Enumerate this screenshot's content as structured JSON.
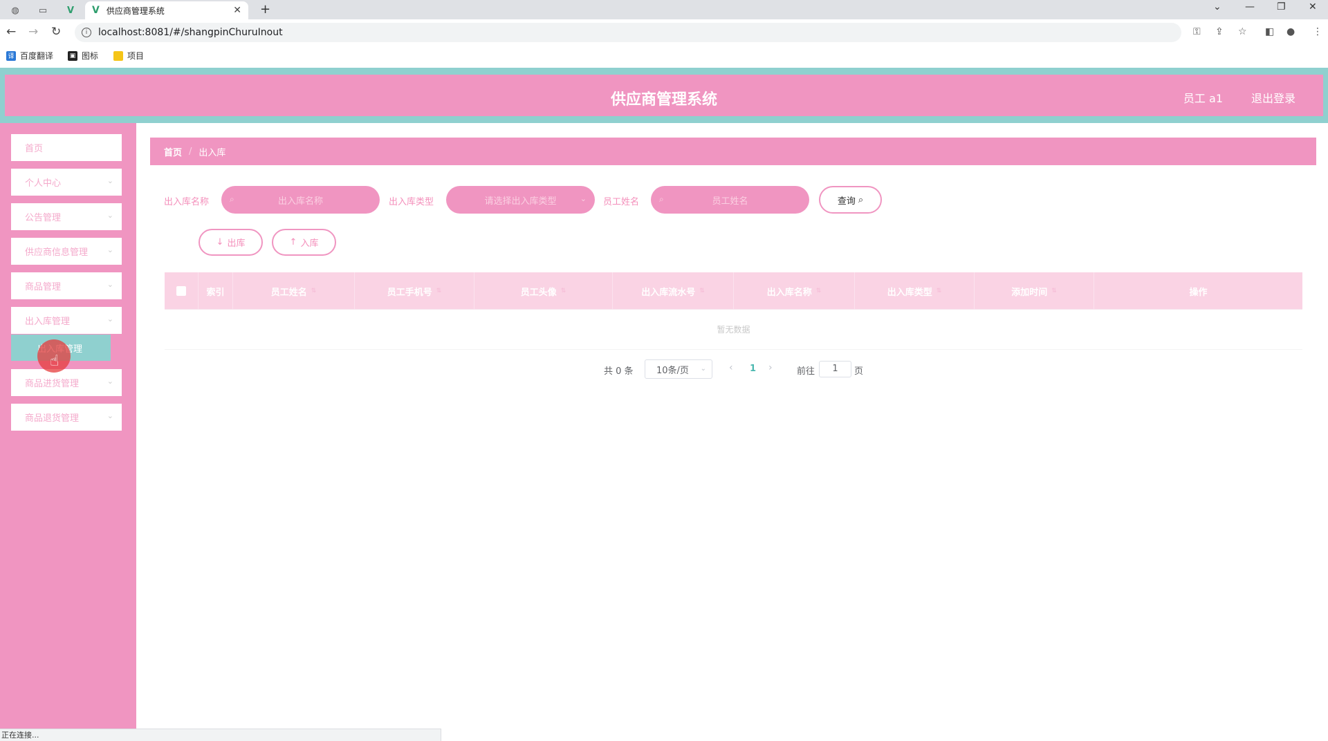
{
  "browser": {
    "tab_title": "供应商管理系统",
    "url": "localhost:8081/#/shangpinChuruInout",
    "bookmarks": [
      {
        "label": "百度翻译",
        "icon": "translate-icon"
      },
      {
        "label": "图标",
        "icon": "image-icon"
      },
      {
        "label": "项目",
        "icon": "folder-icon"
      }
    ],
    "status_text": "正在连接..."
  },
  "header": {
    "title": "供应商管理系统",
    "user": "员工 a1",
    "logout": "退出登录"
  },
  "sidebar": {
    "items": [
      {
        "label": "首页"
      },
      {
        "label": "个人中心"
      },
      {
        "label": "公告管理"
      },
      {
        "label": "供应商信息管理"
      },
      {
        "label": "商品管理"
      },
      {
        "label": "出入库管理"
      },
      {
        "label": "出入库管理",
        "sub": true
      },
      {
        "label": "商品进货管理"
      },
      {
        "label": "商品退货管理"
      }
    ]
  },
  "breadcrumb": {
    "home": "首页",
    "current": "出入库"
  },
  "filters": {
    "name_label": "出入库名称",
    "name_placeholder": "出入库名称",
    "type_label": "出入库类型",
    "type_placeholder": "请选择出入库类型",
    "staff_label": "员工姓名",
    "staff_placeholder": "员工姓名",
    "query_label": "查询"
  },
  "actions": {
    "out_label": "出库",
    "in_label": "入库"
  },
  "table": {
    "columns": [
      "索引",
      "员工姓名",
      "员工手机号",
      "员工头像",
      "出入库流水号",
      "出入库名称",
      "出入库类型",
      "添加时间",
      "操作"
    ],
    "empty_text": "暂无数据"
  },
  "pagination": {
    "total": "共 0 条",
    "page_size": "10条/页",
    "current_page": "1",
    "goto_label": "前往",
    "goto_value": "1",
    "page_suffix": "页"
  },
  "colors": {
    "primary": "#f095c1",
    "accent": "#8fd0cf",
    "active_page": "#4bb8b0"
  }
}
